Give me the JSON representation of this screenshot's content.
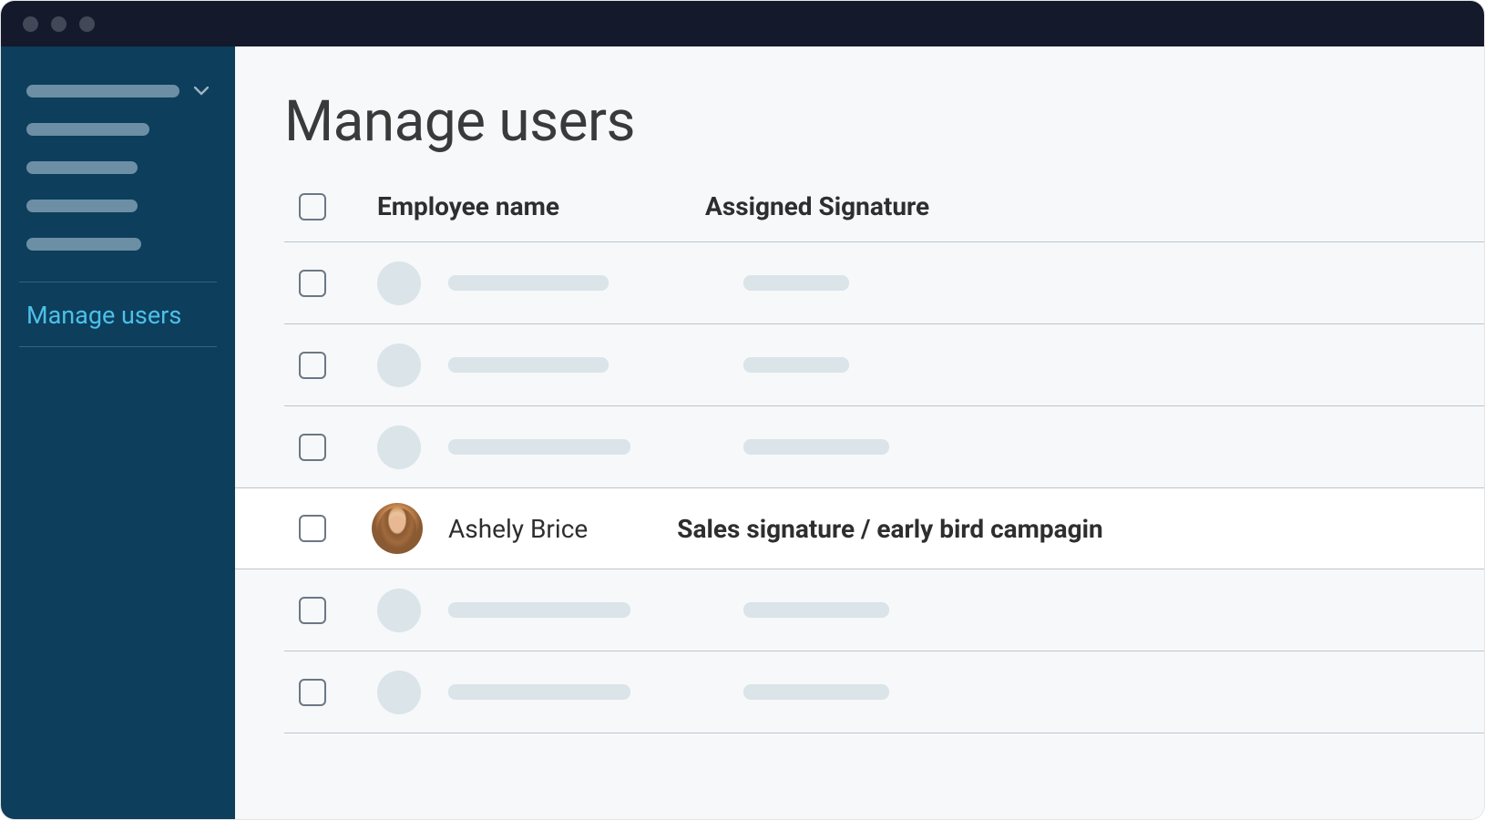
{
  "sidebar": {
    "active_label": "Manage users"
  },
  "page": {
    "title": "Manage users"
  },
  "table": {
    "headers": {
      "name": "Employee name",
      "signature": "Assigned Signature"
    },
    "highlighted_row": {
      "name": "Ashely Brice",
      "signature": "Sales  signature / early bird campagin"
    }
  }
}
